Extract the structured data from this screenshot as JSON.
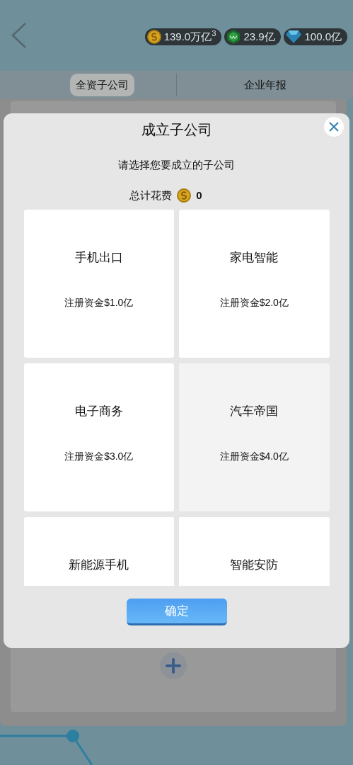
{
  "currencies": [
    {
      "kind": "coin",
      "value": "139.0万亿$^{3}$"
    },
    {
      "kind": "gem",
      "value": "23.9亿"
    },
    {
      "kind": "diamond",
      "value": "100.0亿"
    }
  ],
  "tabs": [
    {
      "label": "全资子公司",
      "selected": true
    },
    {
      "label": "企业年报",
      "selected": false
    }
  ],
  "dialog": {
    "title": "成立子公司",
    "prompt": "请选择您要成立的子公司",
    "total_label": "总计花费",
    "total_value": "0",
    "options": [
      {
        "name": "手机出口",
        "capital": "注册资金$1.0亿",
        "selected": false
      },
      {
        "name": "家电智能",
        "capital": "注册资金$2.0亿",
        "selected": false
      },
      {
        "name": "电子商务",
        "capital": "注册资金$3.0亿",
        "selected": false
      },
      {
        "name": "汽车帝国",
        "capital": "注册资金$4.0亿",
        "selected": true
      },
      {
        "name": "新能源手机",
        "selected": false
      },
      {
        "name": "智能安防",
        "selected": false
      }
    ],
    "confirm": "确定"
  }
}
